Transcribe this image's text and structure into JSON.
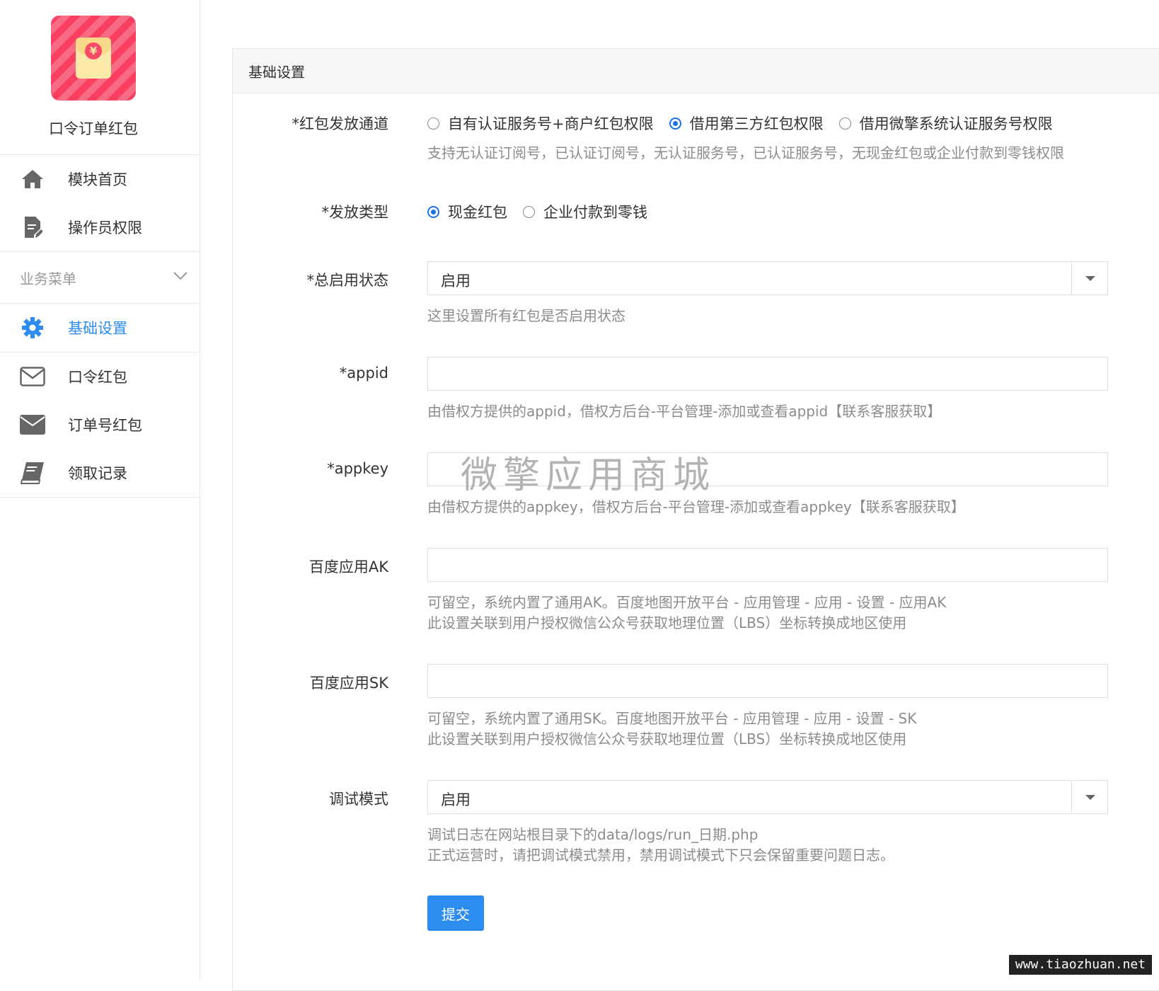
{
  "app": {
    "name": "口令订单红包"
  },
  "sidebar": {
    "top_items": [
      {
        "label": "模块首页",
        "icon": "home-icon"
      },
      {
        "label": "操作员权限",
        "icon": "document-edit-icon"
      }
    ],
    "section_title": "业务菜单",
    "items": [
      {
        "label": "基础设置",
        "icon": "gear-icon",
        "active": true
      },
      {
        "label": "口令红包",
        "icon": "envelope-outline-icon"
      },
      {
        "label": "订单号红包",
        "icon": "envelope-filled-icon"
      },
      {
        "label": "领取记录",
        "icon": "book-icon"
      }
    ]
  },
  "panel": {
    "title": "基础设置"
  },
  "form": {
    "channel": {
      "label": "*红包发放通道",
      "options": [
        "自有认证服务号+商户红包权限",
        "借用第三方红包权限",
        "借用微擎系统认证服务号权限"
      ],
      "selected": 1,
      "help": "支持无认证订阅号，已认证订阅号，无认证服务号，已认证服务号，无现金红包或企业付款到零钱权限"
    },
    "type": {
      "label": "*发放类型",
      "options": [
        "现金红包",
        "企业付款到零钱"
      ],
      "selected": 0
    },
    "status": {
      "label": "*总启用状态",
      "value": "启用",
      "help": "这里设置所有红包是否启用状态"
    },
    "appid": {
      "label": "*appid",
      "value": "",
      "help": "由借权方提供的appid，借权方后台-平台管理-添加或查看appid【联系客服获取】"
    },
    "appkey": {
      "label": "*appkey",
      "value": "",
      "watermark": "微擎应用商城",
      "help": "由借权方提供的appkey，借权方后台-平台管理-添加或查看appkey【联系客服获取】"
    },
    "baidu_ak": {
      "label": "百度应用AK",
      "value": "",
      "help1": "可留空，系统内置了通用AK。百度地图开放平台 - 应用管理 - 应用 - 设置 - 应用AK",
      "help2": "此设置关联到用户授权微信公众号获取地理位置（LBS）坐标转换成地区使用"
    },
    "baidu_sk": {
      "label": "百度应用SK",
      "value": "",
      "help1": "可留空，系统内置了通用SK。百度地图开放平台 - 应用管理 - 应用 - 设置 - SK",
      "help2": "此设置关联到用户授权微信公众号获取地理位置（LBS）坐标转换成地区使用"
    },
    "debug": {
      "label": "调试模式",
      "value": "启用",
      "help1": "调试日志在网站根目录下的data/logs/run_日期.php",
      "help2": "正式运营时，请把调试模式禁用，禁用调试模式下只会保留重要问题日志。"
    },
    "submit_label": "提交"
  },
  "stamp": "www.tiaozhuan.net",
  "colors": {
    "accent": "#2d8cf0",
    "logo": "#fb3f60"
  }
}
